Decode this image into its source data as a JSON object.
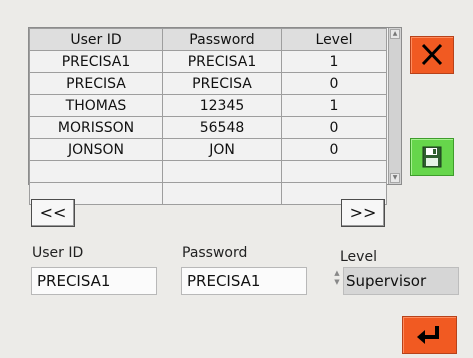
{
  "users_table": {
    "headers": [
      "User ID",
      "Password",
      "Level"
    ],
    "rows": [
      [
        "PRECISA1",
        "PRECISA1",
        "1"
      ],
      [
        "PRECISA",
        "PRECISA",
        "0"
      ],
      [
        "THOMAS",
        "12345",
        "1"
      ],
      [
        "MORISSON",
        "56548",
        "0"
      ],
      [
        "JONSON",
        "JON",
        "0"
      ],
      [
        "",
        "",
        ""
      ]
    ]
  },
  "nav": {
    "prev_label": "<<",
    "next_label": ">>"
  },
  "form": {
    "user_id_label": "User ID",
    "user_id_value": "PRECISA1",
    "password_label": "Password",
    "password_value": "PRECISA1",
    "level_label": "Level",
    "level_value": "Supervisor"
  },
  "buttons": {
    "close_icon": "close-icon",
    "save_icon": "floppy-disk-icon",
    "enter_icon": "enter-return-icon"
  },
  "colors": {
    "close_button": "#f15a22",
    "save_button": "#66d64b",
    "enter_button": "#f15a22",
    "background": "#ecebe8"
  }
}
